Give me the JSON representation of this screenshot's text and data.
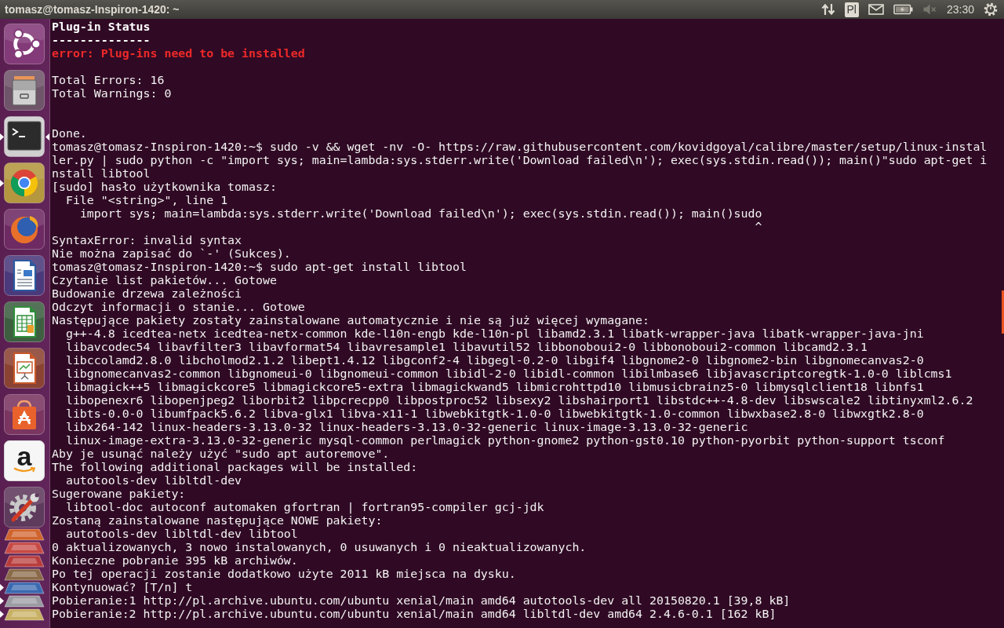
{
  "top_bar": {
    "title": "tomasz@tomasz-Inspiron-1420: ~",
    "keyboard_layout": "Pl",
    "volume": {
      "muted": true
    },
    "clock": "23:30"
  },
  "launcher": {
    "apps": [
      {
        "kind": "ubuntu",
        "running": false,
        "focused": false
      },
      {
        "kind": "files",
        "running": false,
        "focused": false
      },
      {
        "kind": "terminal",
        "running": true,
        "focused": true
      },
      {
        "kind": "chrome",
        "running": true,
        "focused": false
      },
      {
        "kind": "firefox",
        "running": false,
        "focused": false
      },
      {
        "kind": "writer",
        "running": false,
        "focused": false
      },
      {
        "kind": "calc",
        "running": false,
        "focused": false
      },
      {
        "kind": "impress",
        "running": false,
        "focused": false
      },
      {
        "kind": "store",
        "running": false,
        "focused": false
      },
      {
        "kind": "amazon",
        "glyph": "a",
        "running": false,
        "focused": false
      },
      {
        "kind": "settings",
        "running": false,
        "focused": false
      }
    ],
    "stack": [
      {
        "running": false
      },
      {
        "running": false
      },
      {
        "running": false
      },
      {
        "running": false
      },
      {
        "running": true
      },
      {
        "running": true
      },
      {
        "running": true
      }
    ]
  },
  "terminal": {
    "lines": [
      {
        "kind": "bold",
        "text": "Plug-in Status"
      },
      {
        "kind": "bold",
        "text": "--------------"
      },
      {
        "kind": "error",
        "text": "error: Plug-ins need to be installed"
      },
      {
        "kind": "blank"
      },
      {
        "kind": "plain",
        "text": "Total Errors: 16"
      },
      {
        "kind": "plain",
        "text": "Total Warnings: 0"
      },
      {
        "kind": "blank"
      },
      {
        "kind": "blank"
      },
      {
        "kind": "plain",
        "text": "Done."
      },
      {
        "kind": "plain",
        "text": "tomasz@tomasz-Inspiron-1420:~$ sudo -v && wget -nv -O- https://raw.githubusercontent.com/kovidgoyal/calibre/master/setup/linux-instal"
      },
      {
        "kind": "plain",
        "text": "ler.py | sudo python -c \"import sys; main=lambda:sys.stderr.write('Download failed\\n'); exec(sys.stdin.read()); main()\"sudo apt-get i"
      },
      {
        "kind": "plain",
        "text": "nstall libtool"
      },
      {
        "kind": "plain",
        "text": "[sudo] hasło użytkownika tomasz:"
      },
      {
        "kind": "plain",
        "text": "  File \"<string>\", line 1"
      },
      {
        "kind": "plain",
        "text": "    import sys; main=lambda:sys.stderr.write('Download failed\\n'); exec(sys.stdin.read()); main()sudo"
      },
      {
        "kind": "plain",
        "text": "                                                                                                    ^"
      },
      {
        "kind": "plain",
        "text": "SyntaxError: invalid syntax"
      },
      {
        "kind": "plain",
        "text": "Nie można zapisać do `-' (Sukces)."
      },
      {
        "kind": "plain",
        "text": "tomasz@tomasz-Inspiron-1420:~$ sudo apt-get install libtool"
      },
      {
        "kind": "plain",
        "text": "Czytanie list pakietów... Gotowe"
      },
      {
        "kind": "plain",
        "text": "Budowanie drzewa zależności"
      },
      {
        "kind": "plain",
        "text": "Odczyt informacji o stanie... Gotowe"
      },
      {
        "kind": "plain",
        "text": "Następujące pakiety zostały zainstalowane automatycznie i nie są już więcej wymagane:"
      },
      {
        "kind": "plain",
        "text": "  g++-4.8 icedtea-netx icedtea-netx-common kde-l10n-engb kde-l10n-pl libamd2.3.1 libatk-wrapper-java libatk-wrapper-java-jni"
      },
      {
        "kind": "plain",
        "text": "  libavcodec54 libavfilter3 libavformat54 libavresample1 libavutil52 libbonoboui2-0 libbonoboui2-common libcamd2.3.1"
      },
      {
        "kind": "plain",
        "text": "  libccolamd2.8.0 libcholmod2.1.2 libept1.4.12 libgconf2-4 libgegl-0.2-0 libgif4 libgnome2-0 libgnome2-bin libgnomecanvas2-0"
      },
      {
        "kind": "plain",
        "text": "  libgnomecanvas2-common libgnomeui-0 libgnomeui-common libidl-2-0 libidl-common libilmbase6 libjavascriptcoregtk-1.0-0 liblcms1"
      },
      {
        "kind": "plain",
        "text": "  libmagick++5 libmagickcore5 libmagickcore5-extra libmagickwand5 libmicrohttpd10 libmusicbrainz5-0 libmysqlclient18 libnfs1"
      },
      {
        "kind": "plain",
        "text": "  libopenexr6 libopenjpeg2 liborbit2 libpcrecpp0 libpostproc52 libsexy2 libshairport1 libstdc++-4.8-dev libswscale2 libtinyxml2.6.2"
      },
      {
        "kind": "plain",
        "text": "  libts-0.0-0 libumfpack5.6.2 libva-glx1 libva-x11-1 libwebkitgtk-1.0-0 libwebkitgtk-1.0-common libwxbase2.8-0 libwxgtk2.8-0"
      },
      {
        "kind": "plain",
        "text": "  libx264-142 linux-headers-3.13.0-32 linux-headers-3.13.0-32-generic linux-image-3.13.0-32-generic"
      },
      {
        "kind": "plain",
        "text": "  linux-image-extra-3.13.0-32-generic mysql-common perlmagick python-gnome2 python-gst0.10 python-pyorbit python-support tsconf"
      },
      {
        "kind": "plain",
        "text": "Aby je usunąć należy użyć \"sudo apt autoremove\"."
      },
      {
        "kind": "plain",
        "text": "The following additional packages will be installed:"
      },
      {
        "kind": "plain",
        "text": "  autotools-dev libltdl-dev"
      },
      {
        "kind": "plain",
        "text": "Sugerowane pakiety:"
      },
      {
        "kind": "plain",
        "text": "  libtool-doc autoconf automaken gfortran | fortran95-compiler gcj-jdk"
      },
      {
        "kind": "plain",
        "text": "Zostaną zainstalowane następujące NOWE pakiety:"
      },
      {
        "kind": "plain",
        "text": "  autotools-dev libltdl-dev libtool"
      },
      {
        "kind": "plain",
        "text": "0 aktualizowanych, 3 nowo instalowanych, 0 usuwanych i 0 nieaktualizowanych."
      },
      {
        "kind": "plain",
        "text": "Konieczne pobranie 395 kB archiwów."
      },
      {
        "kind": "plain",
        "text": "Po tej operacji zostanie dodatkowo użyte 2011 kB miejsca na dysku."
      },
      {
        "kind": "plain",
        "text": "Kontynuować? [T/n] t"
      },
      {
        "kind": "plain",
        "text": "Pobieranie:1 http://pl.archive.ubuntu.com/ubuntu xenial/main amd64 autotools-dev all 20150820.1 [39,8 kB]"
      },
      {
        "kind": "plain",
        "text": "Pobieranie:2 http://pl.archive.ubuntu.com/ubuntu xenial/main amd64 libltdl-dev amd64 2.4.6-0.1 [162 kB]"
      }
    ]
  }
}
